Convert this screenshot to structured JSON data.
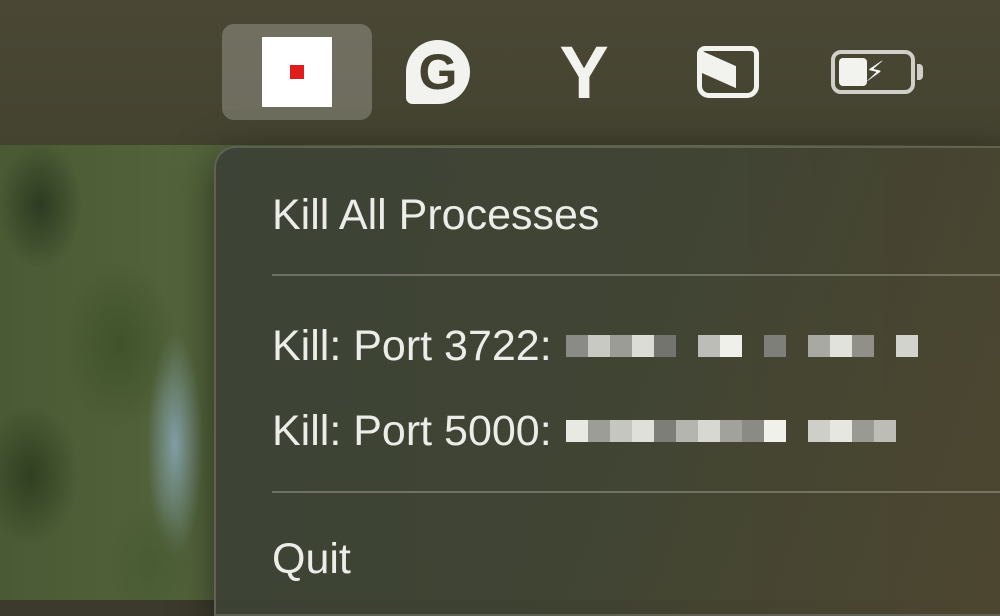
{
  "menubar": {
    "items": [
      {
        "name": "stop-app",
        "icon": "stop-square-icon",
        "active": true
      },
      {
        "name": "grammarly",
        "icon": "grammarly-icon",
        "glyph": "G"
      },
      {
        "name": "y-app",
        "icon": "y-icon",
        "glyph": "Y"
      },
      {
        "name": "hand-mirror",
        "icon": "hand-icon"
      },
      {
        "name": "battery",
        "icon": "battery-charging-icon"
      }
    ]
  },
  "dropdown": {
    "items": [
      {
        "label": "Kill All Processes"
      },
      {
        "label": "Kill: Port 3722:"
      },
      {
        "label": "Kill: Port 5000:"
      },
      {
        "label": "Quit"
      }
    ]
  },
  "colors": {
    "menubar": "#444330",
    "menu_text": "#ecece8",
    "stop_red": "#e21c1c"
  }
}
